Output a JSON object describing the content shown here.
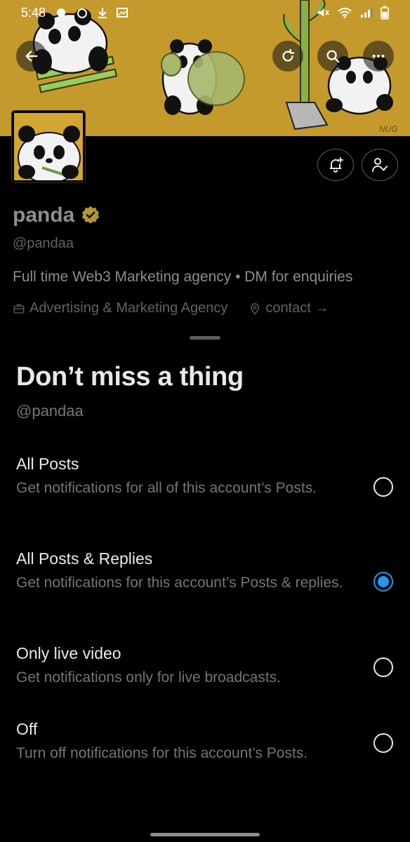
{
  "status_bar": {
    "time": "5:48",
    "right_icons": [
      "mute-icon",
      "wifi-icon",
      "signal-icon",
      "battery-icon"
    ]
  },
  "header": {
    "back_icon": "arrow-left-icon",
    "refresh_icon": "refresh-icon",
    "search_icon": "search-icon",
    "more_icon": "more-icon",
    "banner_signature": "NUG"
  },
  "profile": {
    "name": "panda",
    "handle": "@pandaa",
    "bio": "Full time Web3 Marketing agency • DM for enquiries",
    "category": "Advertising & Marketing Agency",
    "link": "contact →",
    "verified_color": "#b8962e"
  },
  "sheet": {
    "title": "Don’t miss a thing",
    "handle": "@pandaa",
    "options": [
      {
        "title": "All Posts",
        "desc": "Get notifications for all of this account’s Posts.",
        "selected": false
      },
      {
        "title": "All Posts & Replies",
        "desc": "Get notifications for this account’s Posts & replies.",
        "selected": true
      },
      {
        "title": "Only live video",
        "desc": "Get notifications only for live broadcasts.",
        "selected": false
      },
      {
        "title": "Off",
        "desc": "Turn off notifications for this account’s Posts.",
        "selected": false
      }
    ]
  },
  "colors": {
    "accent": "#1d9bf0",
    "banner": "#c49a2c",
    "background": "#000000"
  }
}
